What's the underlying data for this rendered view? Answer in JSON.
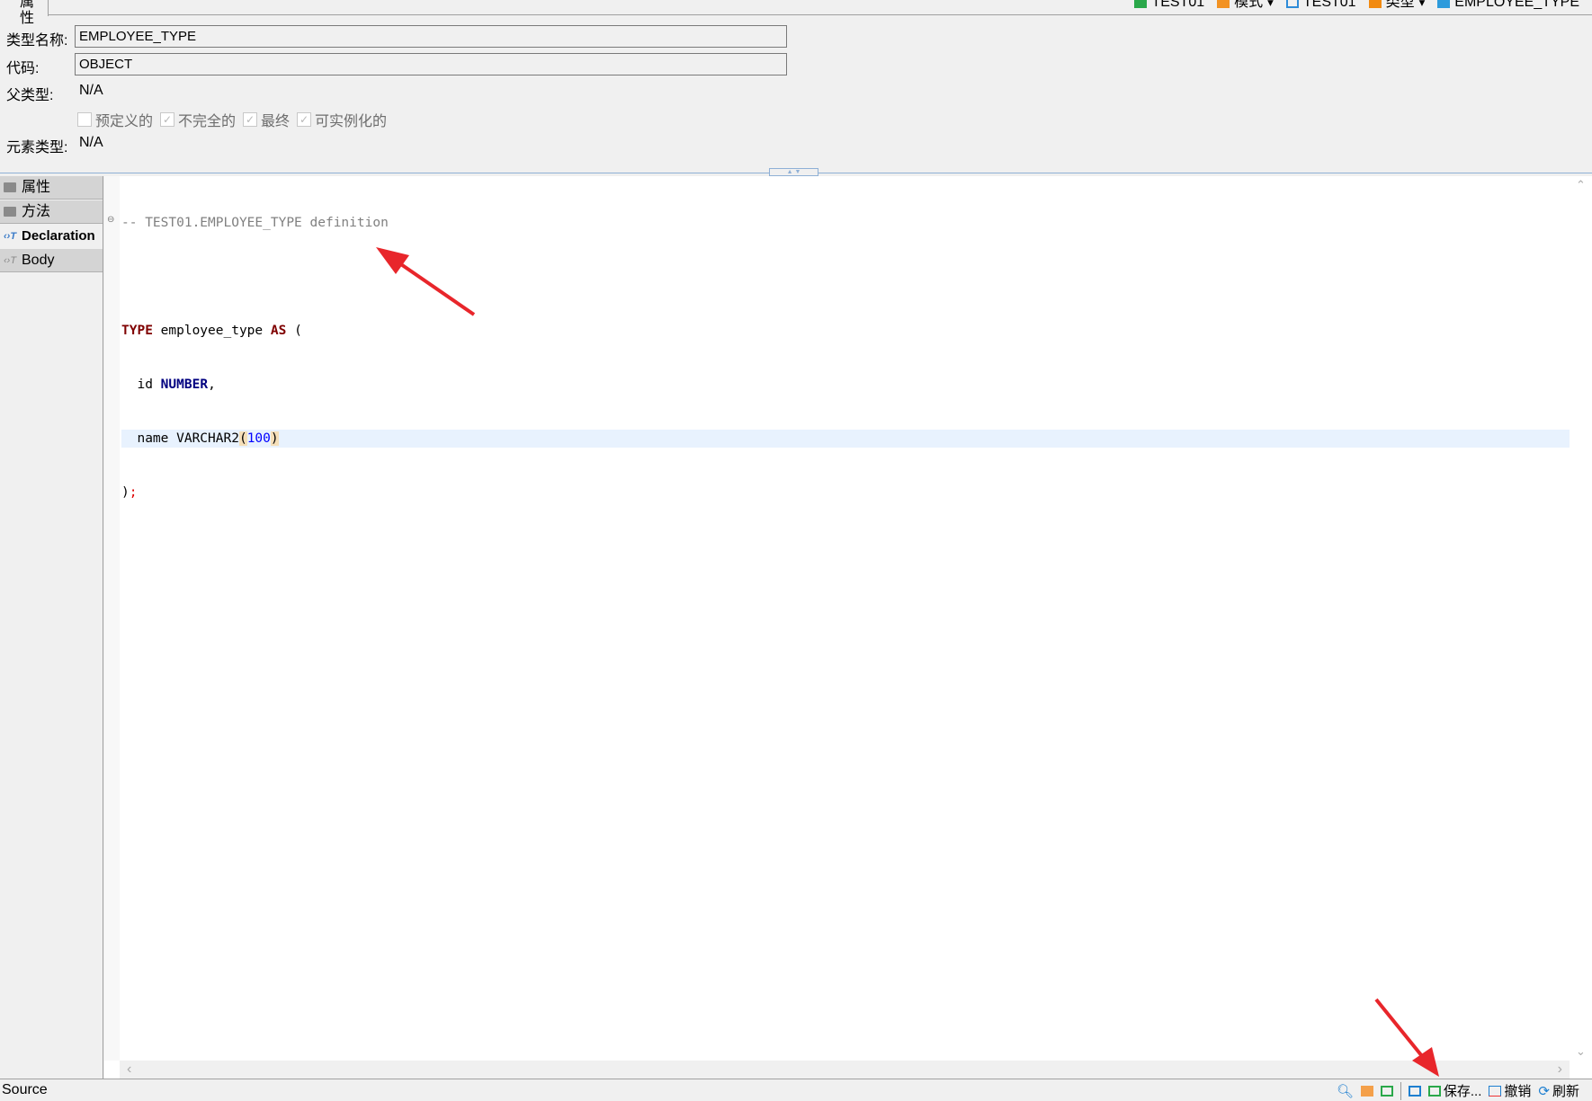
{
  "tabs": {
    "active": "属性"
  },
  "breadcrumb": [
    {
      "label": "TEST01",
      "icon": "connection-check-icon"
    },
    {
      "label": "模式",
      "icon": "schema-icon",
      "dropdown": true
    },
    {
      "label": "TEST01",
      "icon": "schema-db-icon"
    },
    {
      "label": "类型",
      "icon": "type-folder-icon",
      "dropdown": true
    },
    {
      "label": "EMPLOYEE_TYPE",
      "icon": "type-icon"
    }
  ],
  "form": {
    "type_name_label": "类型名称:",
    "type_name": "EMPLOYEE_TYPE",
    "code_label": "代码:",
    "code": "OBJECT",
    "parent_label": "父类型:",
    "parent": "N/A",
    "element_label": "元素类型:",
    "element": "N/A",
    "checkboxes": [
      {
        "label": "预定义的",
        "checked": false
      },
      {
        "label": "不完全的",
        "checked": true
      },
      {
        "label": "最终",
        "checked": true
      },
      {
        "label": "可实例化的",
        "checked": true
      }
    ]
  },
  "sidebar": {
    "items": [
      {
        "label": "属性",
        "icon": "folder-icon"
      },
      {
        "label": "方法",
        "icon": "folder-icon"
      },
      {
        "label": "Declaration",
        "icon": "text-icon",
        "active": true
      },
      {
        "label": "Body",
        "icon": "text-icon"
      }
    ]
  },
  "code": {
    "comment": "-- TEST01.EMPLOYEE_TYPE definition",
    "kw_type": "TYPE",
    "type_name": " employee_type ",
    "kw_as": "AS",
    "open": " (",
    "indent": "  ",
    "id": "id ",
    "number": "NUMBER",
    "comma": ",",
    "name": "name VARCHAR2",
    "lp": "(",
    "len": "100",
    "rp": ")",
    "close_paren": ")",
    "semi": ";"
  },
  "status": {
    "mode": "Source",
    "save": "保存...",
    "revert": "撤销",
    "refresh": "刷新"
  },
  "colors": {
    "annotation_arrow": "#e8262b",
    "highlight_line": "#e8f2fe"
  }
}
